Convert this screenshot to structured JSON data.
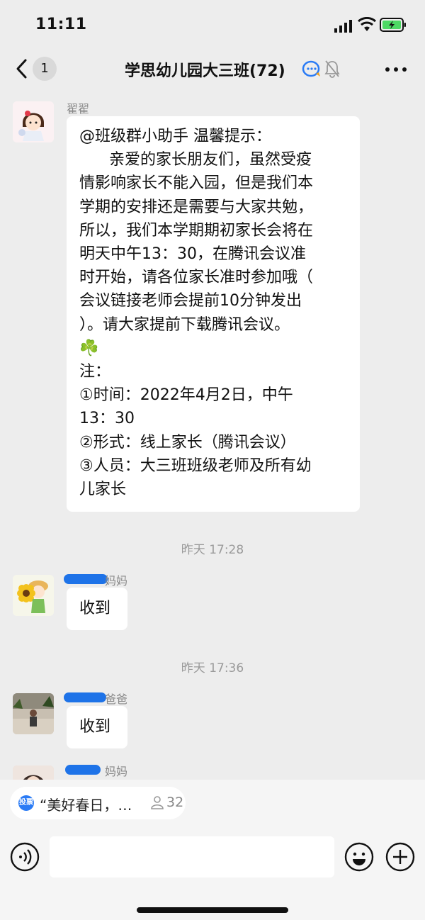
{
  "status_bar": {
    "time": "11:11"
  },
  "header": {
    "back_label": "1",
    "title": "学思幼儿园大三班(72)"
  },
  "messages": [
    {
      "sender": "翟翟",
      "text": "@班级群小助手 温馨提示：\n      亲爱的家长朋友们，虽然受疫\n情影响家长不能入园，但是我们本\n学期的安排还是需要与大家共勉，\n所以，我们本学期期初家长会将在\n明天中午13：30，在腾讯会议准\n时开始，请各位家长准时参加哦（\n会议链接老师会提前10分钟发出\n）。请大家提前下载腾讯会议。\n☘️\n注：\n①时间：2022年4月2日，中午\n13：30\n②形式：线上家长（腾讯会议）\n③人员：大三班班级老师及所有幼\n儿家长"
    },
    {
      "timestamp": "昨天 17:28"
    },
    {
      "sender": "妈妈",
      "text": "收到"
    },
    {
      "timestamp": "昨天 17:36"
    },
    {
      "sender": "爸爸",
      "text": "收到"
    },
    {
      "sender": "妈妈"
    }
  ],
  "vote": {
    "tag": "投票",
    "title": "“美好春日，…",
    "count": "32"
  },
  "colors": {
    "background": "#ededed",
    "bubble": "#ffffff",
    "vote_blue": "#2a7bf5",
    "battery_green": "#4cd964"
  },
  "icons": [
    "back-chevron-icon",
    "signal-icon",
    "wifi-icon",
    "battery-icon",
    "ai-assistant-icon",
    "mute-bell-icon",
    "more-icon",
    "voice-icon",
    "emoji-icon",
    "plus-icon",
    "vote-icon",
    "person-icon"
  ]
}
